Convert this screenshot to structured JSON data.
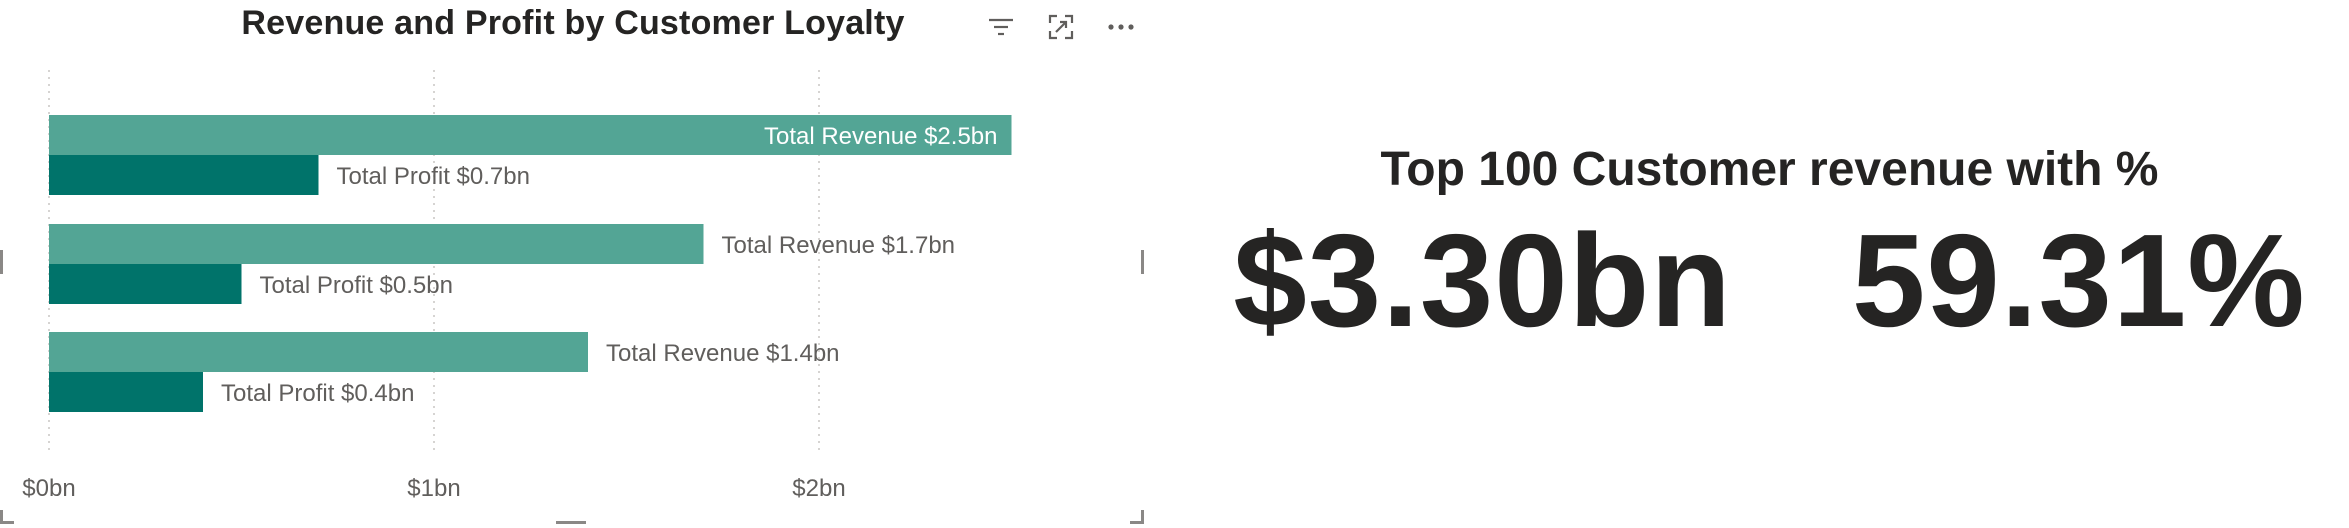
{
  "chart_visual": {
    "title": "Revenue and Profit by Customer Loyalty",
    "header_icons": [
      "filter-icon",
      "focus-mode-icon",
      "more-options-icon"
    ]
  },
  "chart_data": {
    "type": "bar",
    "orientation": "horizontal",
    "title": "Revenue and Profit by Customer Loyalty",
    "categories": [
      "",
      "",
      ""
    ],
    "series": [
      {
        "name": "Total Revenue",
        "values": [
          2.5,
          1.7,
          1.4
        ],
        "labels": [
          "Total Revenue $2.5bn",
          "Total Revenue $1.7bn",
          "Total Revenue $1.4bn"
        ],
        "color": "#53a595"
      },
      {
        "name": "Total Profit",
        "values": [
          0.7,
          0.5,
          0.4
        ],
        "labels": [
          "Total Profit $0.7bn",
          "Total Profit $0.5bn",
          "Total Profit $0.4bn"
        ],
        "color": "#00736a"
      }
    ],
    "x_ticks": [
      "$0bn",
      "$1bn",
      "$2bn"
    ],
    "x_tick_values": [
      0,
      1,
      2
    ],
    "xlim": [
      0,
      2.5
    ],
    "grid": true,
    "legend": "none"
  },
  "kpi_card": {
    "title": "Top 100 Customer revenue with %",
    "revenue_value": "$3.30bn",
    "percent_value": "59.31%"
  }
}
